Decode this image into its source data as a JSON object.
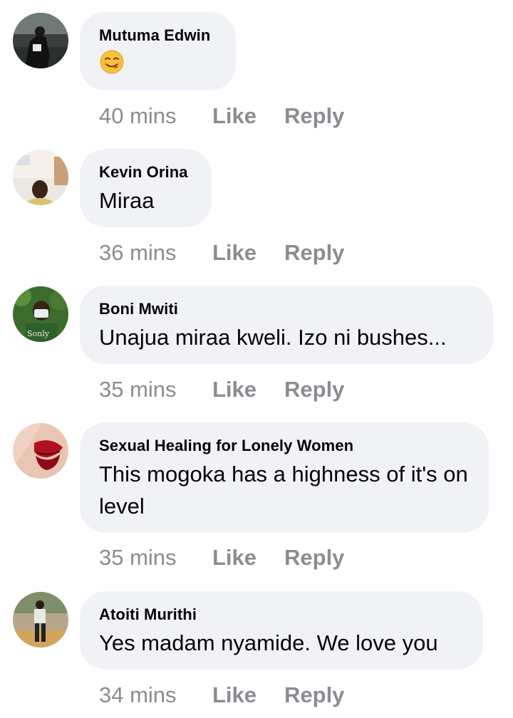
{
  "comments": [
    {
      "author": "Mutuma Edwin",
      "text": "",
      "emoji": "tongue-wink-emoji",
      "time": "40 mins",
      "like_label": "Like",
      "reply_label": "Reply"
    },
    {
      "author": "Kevin Orina",
      "text": "Miraa",
      "time": "36 mins",
      "like_label": "Like",
      "reply_label": "Reply"
    },
    {
      "author": "Boni Mwiti",
      "text": "Unajua miraa kweli. Izo ni bushes...",
      "time": "35 mins",
      "like_label": "Like",
      "reply_label": "Reply"
    },
    {
      "author": "Sexual Healing for Lonely Women",
      "text": "This mogoka has a highness of it's on level",
      "time": "35 mins",
      "like_label": "Like",
      "reply_label": "Reply"
    },
    {
      "author": "Atoiti Murithi",
      "text": "Yes madam nyamide. We love you",
      "time": "34 mins",
      "like_label": "Like",
      "reply_label": "Reply"
    }
  ],
  "colors": {
    "bubble_bg": "#f0f2f5",
    "text": "#050505",
    "meta": "#8a8d91"
  }
}
